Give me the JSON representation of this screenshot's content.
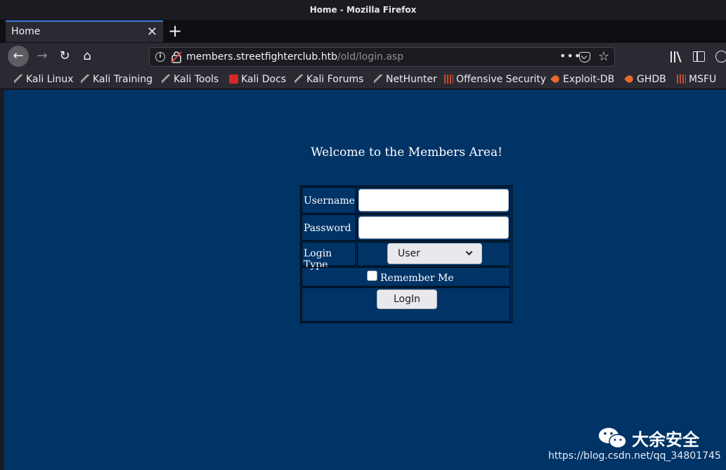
{
  "window": {
    "title": "Home - Mozilla Firefox"
  },
  "tabs": [
    {
      "label": "Home",
      "active": true
    }
  ],
  "toolbar": {
    "url_host": "members.streetfighterclub.htb",
    "url_path": "/old/login.asp",
    "page_actions": "•••"
  },
  "bookmarks": [
    {
      "label": "Kali Linux",
      "icon": "kali-dragon-icon"
    },
    {
      "label": "Kali Training",
      "icon": "kali-dragon-icon"
    },
    {
      "label": "Kali Tools",
      "icon": "kali-dragon-icon"
    },
    {
      "label": "Kali Docs",
      "icon": "kali-docs-icon"
    },
    {
      "label": "Kali Forums",
      "icon": "kali-dragon-icon"
    },
    {
      "label": "NetHunter",
      "icon": "kali-dragon-icon"
    },
    {
      "label": "Offensive Security",
      "icon": "offsec-icon"
    },
    {
      "label": "Exploit-DB",
      "icon": "exploit-db-icon"
    },
    {
      "label": "GHDB",
      "icon": "exploit-db-icon"
    },
    {
      "label": "MSFU",
      "icon": "offsec-icon"
    }
  ],
  "page": {
    "welcome": "Welcome to the Members Area!",
    "username_label": "Username",
    "username_value": "",
    "password_label": "Password",
    "password_value": "",
    "login_type_label": "Login Type",
    "login_type_selected": "User",
    "remember_label": "Remember Me",
    "remember_checked": false,
    "login_button": "LogIn",
    "background_color": "#003366"
  },
  "watermark": {
    "brand": "大余安全",
    "url": "https://blog.csdn.net/qq_34801745"
  }
}
